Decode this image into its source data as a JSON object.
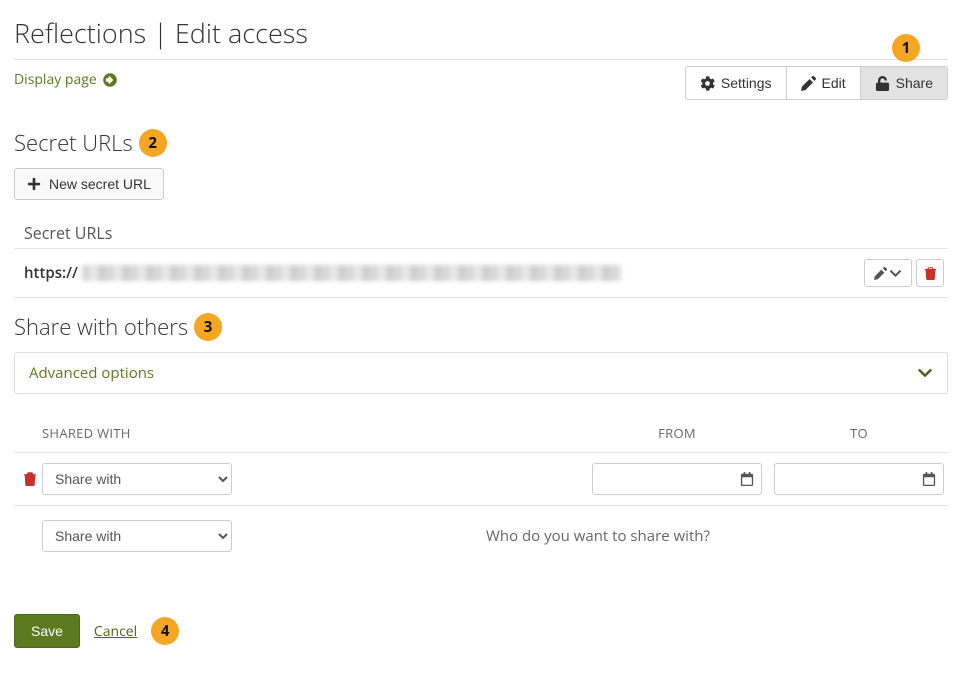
{
  "page": {
    "title": "Reflections | Edit access",
    "display_link": "Display page"
  },
  "tabs": {
    "settings": "Settings",
    "edit": "Edit",
    "share": "Share"
  },
  "secret_urls": {
    "heading": "Secret URLs",
    "new_button": "New secret URL",
    "list_label": "Secret URLs",
    "url_prefix": "https://"
  },
  "share": {
    "heading": "Share with others",
    "advanced": "Advanced options",
    "col_shared": "SHARED WITH",
    "col_from": "FROM",
    "col_to": "TO",
    "select_placeholder": "Share with",
    "prompt": "Who do you want to share with?"
  },
  "footer": {
    "save": "Save",
    "cancel": "Cancel"
  },
  "annotations": {
    "a1": "1",
    "a2": "2",
    "a3": "3",
    "a4": "4"
  }
}
